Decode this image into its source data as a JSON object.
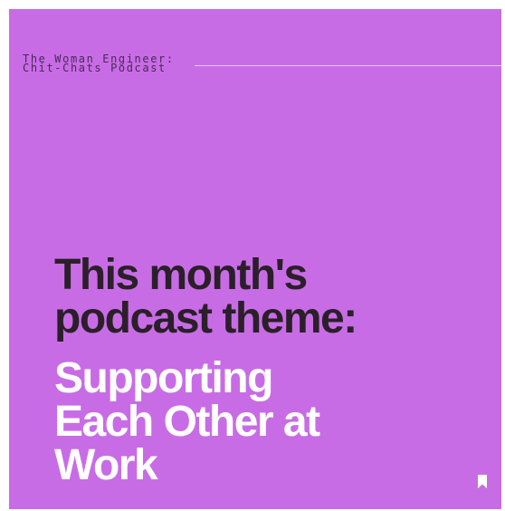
{
  "post": {
    "podcast_name_line1": "The Woman Engineer:",
    "podcast_name_line2": "Chit-Chats Podcast",
    "headline_line1": "This month's",
    "headline_line2": "podcast theme:",
    "theme_line1": "Supporting",
    "theme_line2": "Each Other at",
    "theme_line3": "Work"
  },
  "icons": {
    "bookmark": "bookmark-icon"
  },
  "colors": {
    "background": "#c86ce6",
    "headline": "#2b1f2a",
    "theme_text": "#ffffff"
  }
}
